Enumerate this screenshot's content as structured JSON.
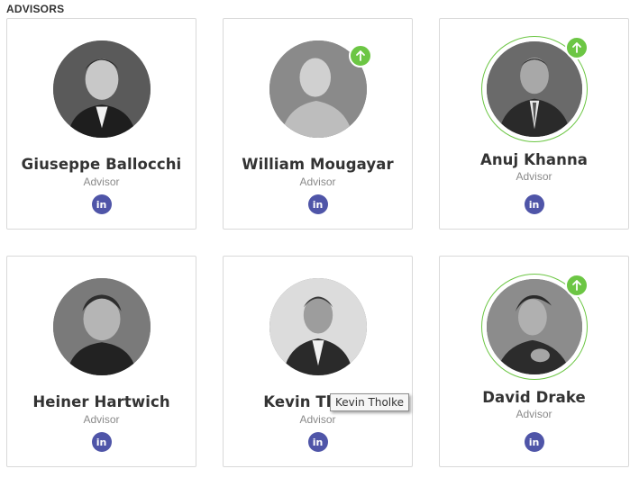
{
  "section": {
    "title": "ADVISORS"
  },
  "advisors": [
    {
      "name": "Giuseppe Ballocchi",
      "role": "Advisor",
      "linkedin": "in",
      "badge_icon": "arrow-up-icon",
      "highlighted": false,
      "has_badge": false
    },
    {
      "name": "William Mougayar",
      "role": "Advisor",
      "linkedin": "in",
      "badge_icon": "arrow-up-icon",
      "highlighted": false,
      "has_badge": true
    },
    {
      "name": "Anuj Khanna",
      "role": "Advisor",
      "linkedin": "in",
      "badge_icon": "arrow-up-icon",
      "highlighted": true,
      "has_badge": true
    },
    {
      "name": "Heiner Hartwich",
      "role": "Advisor",
      "linkedin": "in",
      "badge_icon": "arrow-up-icon",
      "highlighted": false,
      "has_badge": false
    },
    {
      "name": "Kevin Tholke",
      "role": "Advisor",
      "linkedin": "in",
      "badge_icon": "arrow-up-icon",
      "highlighted": false,
      "has_badge": false
    },
    {
      "name": "David Drake",
      "role": "Advisor",
      "linkedin": "in",
      "badge_icon": "arrow-up-icon",
      "highlighted": true,
      "has_badge": true
    }
  ],
  "tooltip": {
    "text": "Kevin Tholke"
  },
  "colors": {
    "badge_green": "#6cc644",
    "linkedin_bg": "#4f55a8",
    "card_border": "#d9d9d9",
    "name_text": "#333333",
    "role_text": "#8a8a8a"
  }
}
